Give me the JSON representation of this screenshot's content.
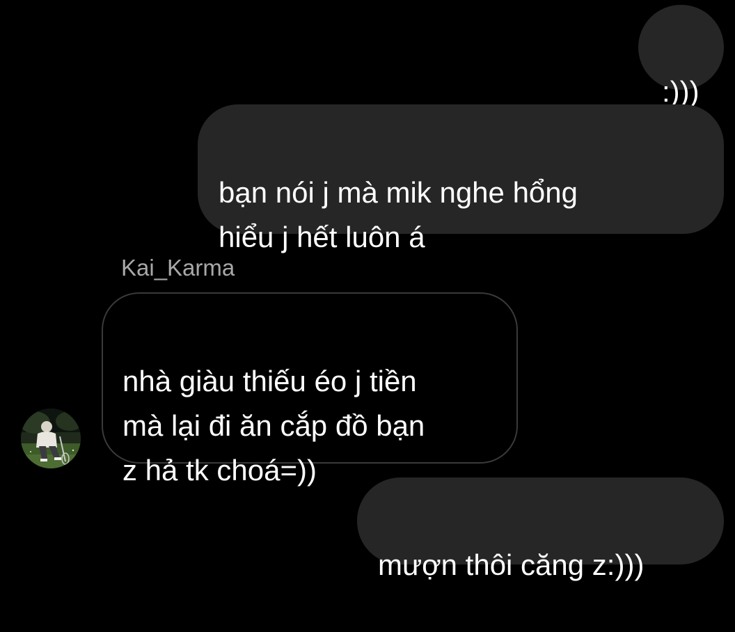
{
  "conversation": {
    "messages": [
      {
        "direction": "outgoing",
        "text": ":)))"
      },
      {
        "direction": "outgoing",
        "text": "bạn nói j mà mik nghe hổng\nhiểu j hết luôn á"
      },
      {
        "direction": "incoming",
        "sender": "Kai_Karma",
        "text": "nhà giàu thiếu éo j tiền\nmà lại đi ăn cắp đồ bạn\nz hả tk choá=))"
      },
      {
        "direction": "outgoing",
        "text": "mượn thôi căng z:)))"
      }
    ],
    "incoming_avatar_icon": "user-photo-avatar"
  },
  "colors": {
    "background": "#000000",
    "outgoing_bubble": "#262626",
    "incoming_bubble_border": "#3a3a3a",
    "sender_name": "#a8a8a8",
    "text": "#ffffff"
  }
}
